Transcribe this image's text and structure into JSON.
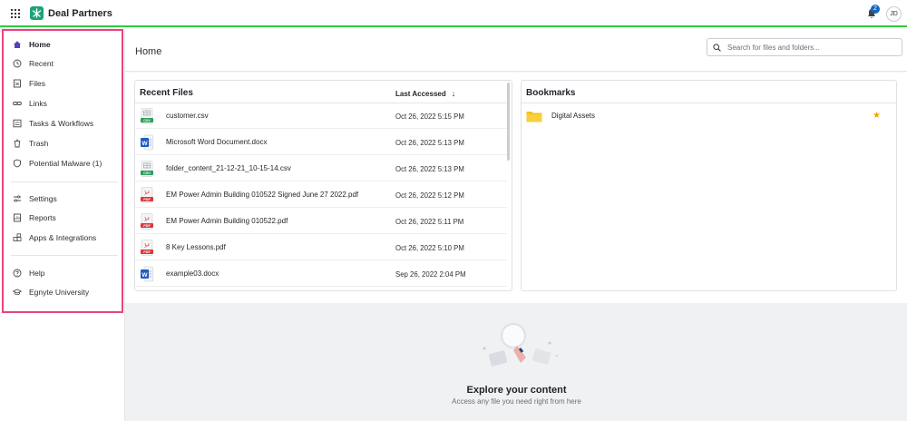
{
  "topbar": {
    "app_name": "Deal Partners",
    "notification_count": "2",
    "user_initials": "JD"
  },
  "sidebar": {
    "items": [
      {
        "label": "Home",
        "icon": "home-icon",
        "active": true
      },
      {
        "label": "Recent",
        "icon": "clock-icon"
      },
      {
        "label": "Files",
        "icon": "file-icon"
      },
      {
        "label": "Links",
        "icon": "link-icon"
      },
      {
        "label": "Tasks & Workflows",
        "icon": "tasks-icon"
      },
      {
        "label": "Trash",
        "icon": "trash-icon"
      },
      {
        "label": "Potential Malware (1)",
        "icon": "shield-icon"
      },
      {
        "label": "Settings",
        "icon": "sliders-icon"
      },
      {
        "label": "Reports",
        "icon": "report-icon"
      },
      {
        "label": "Apps & Integrations",
        "icon": "apps-icon"
      },
      {
        "label": "Help",
        "icon": "help-icon"
      },
      {
        "label": "Egnyte University",
        "icon": "graduation-cap-icon"
      }
    ]
  },
  "header": {
    "title": "Home",
    "search_placeholder": "Search for files and folders..."
  },
  "recent_files": {
    "title": "Recent Files",
    "col_last_accessed": "Last Accessed",
    "sort_arrow": "↓",
    "rows": [
      {
        "name": "customer.csv",
        "date": "Oct 26, 2022 5:15 PM",
        "type": "csv"
      },
      {
        "name": "Microsoft Word Document.docx",
        "date": "Oct 26, 2022 5:13 PM",
        "type": "docx"
      },
      {
        "name": "folder_content_21-12-21_10-15-14.csv",
        "date": "Oct 26, 2022 5:13 PM",
        "type": "csv"
      },
      {
        "name": "EM Power Admin Building 010522 Signed June 27 2022.pdf",
        "date": "Oct 26, 2022 5:12 PM",
        "type": "pdf"
      },
      {
        "name": "EM Power Admin Building 010522.pdf",
        "date": "Oct 26, 2022 5:11 PM",
        "type": "pdf"
      },
      {
        "name": "8 Key Lessons.pdf",
        "date": "Oct 26, 2022 5:10 PM",
        "type": "pdf"
      },
      {
        "name": "example03.docx",
        "date": "Sep 26, 2022 2:04 PM",
        "type": "docx"
      }
    ]
  },
  "bookmarks": {
    "title": "Bookmarks",
    "items": [
      {
        "name": "Digital Assets",
        "starred": true
      }
    ]
  },
  "explore": {
    "title": "Explore your content",
    "subtitle": "Access any file you need right from here"
  },
  "badges": {
    "csv": "CSV",
    "pdf": "PDF",
    "doc": "W"
  },
  "colors": {
    "brand": "#1aa37a",
    "accent_border": "#e8457a",
    "topbar_border": "#2ecc40",
    "star": "#f2a300",
    "pdf": "#d9383a",
    "csv": "#2e9d5c",
    "word": "#1f5cc4",
    "folder": "#f6c21b"
  }
}
